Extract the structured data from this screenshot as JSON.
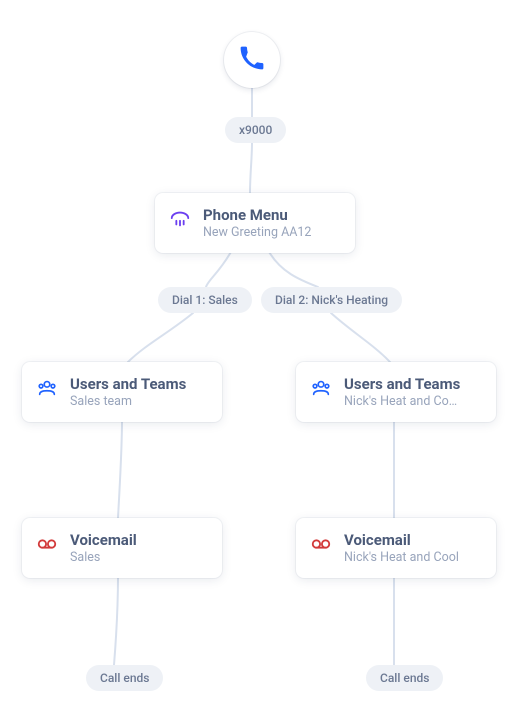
{
  "start": {
    "icon": "phone"
  },
  "root_tag": "x9000",
  "menu": {
    "title": "Phone Menu",
    "subtitle": "New Greeting AA12",
    "icon": "ivr"
  },
  "branches": [
    {
      "tag": "Dial 1: Sales"
    },
    {
      "tag": "Dial 2: Nick's Heating"
    }
  ],
  "users_teams": {
    "left": {
      "title": "Users and Teams",
      "subtitle": "Sales team",
      "icon": "team"
    },
    "right": {
      "title": "Users and Teams",
      "subtitle": "Nick's Heat and Co…",
      "icon": "team"
    }
  },
  "voicemail": {
    "left": {
      "title": "Voicemail",
      "subtitle": "Sales",
      "icon": "voicemail"
    },
    "right": {
      "title": "Voicemail",
      "subtitle": "Nick's Heat and Cool",
      "icon": "voicemail"
    }
  },
  "end_tag": {
    "left": "Call ends",
    "right": "Call ends"
  },
  "colors": {
    "line": "#d8e0ed",
    "accent": "#1f62ff",
    "ivr": "#6b3ff0",
    "vm": "#d23a3a"
  }
}
